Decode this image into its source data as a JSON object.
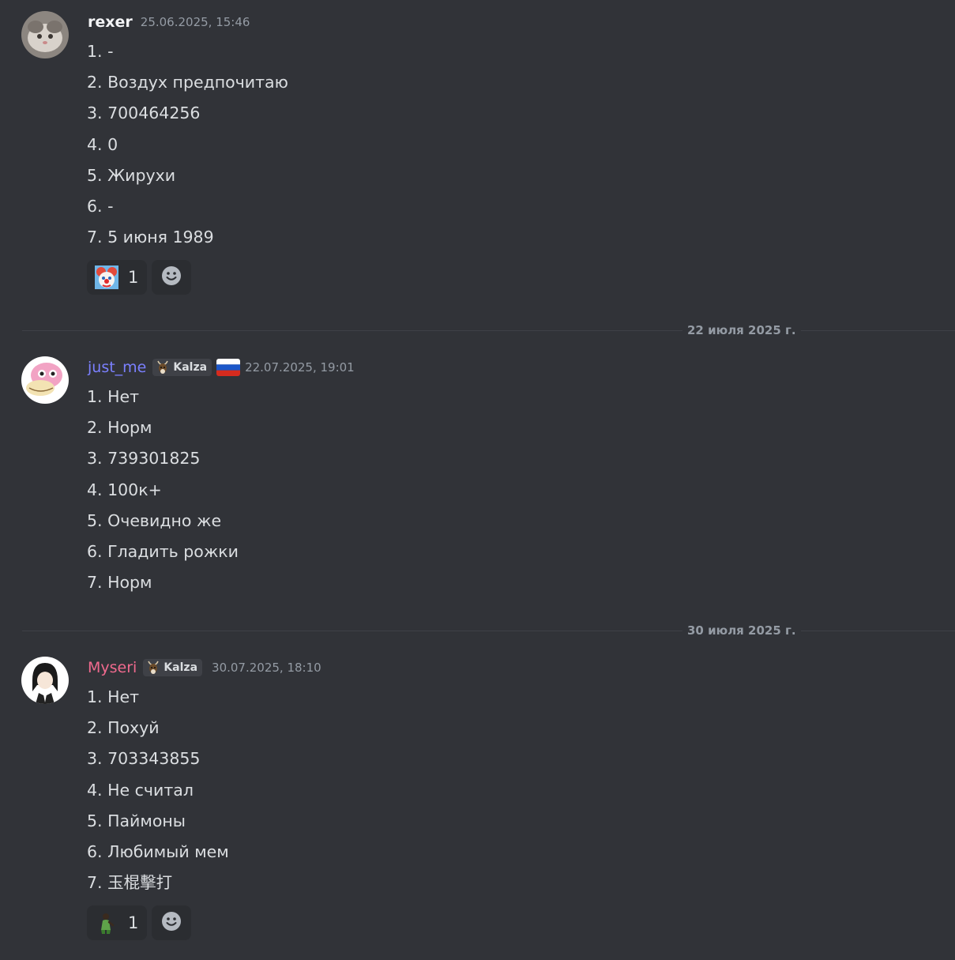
{
  "messages": [
    {
      "author": "rexer",
      "timestamp": "25.06.2025, 15:46",
      "lines": [
        "1. -",
        "2. Воздух предпочитаю",
        "3. 700464256",
        "4. 0",
        "5. Жирухи",
        "6. -",
        "7. 5 июня 1989"
      ],
      "reactions": [
        {
          "emoji": "clown-face-emoji",
          "count": "1"
        }
      ]
    },
    {
      "author": "just_me",
      "name_color": "#7b80ff",
      "tag": "Kalza",
      "flag": "russia-flag",
      "timestamp": "22.07.2025, 19:01",
      "lines": [
        "1. Нет",
        "2. Норм",
        "3. 739301825",
        "4. 100к+",
        "5. Очевидно же",
        "6. Гладить рожки",
        "7. Норм"
      ]
    },
    {
      "author": "Myseri",
      "name_color": "#f06a8e",
      "tag": "Kalza",
      "timestamp": "30.07.2025, 18:10",
      "lines": [
        "1. Нет",
        "2. Похуй",
        "3. 703343855",
        "4. Не считал",
        "5. Паймоны",
        "6. Любимый мем",
        "7. 玉棍擊打"
      ],
      "reactions": [
        {
          "emoji": "person-emoji",
          "count": "1"
        }
      ]
    }
  ],
  "dividers": [
    {
      "label": "22 июля 2025 г."
    },
    {
      "label": "30 июля 2025 г."
    }
  ],
  "colors": {
    "background": "#313338",
    "text": "#dbdee1",
    "muted": "#949ba4",
    "reaction_bg": "#2b2d31"
  }
}
